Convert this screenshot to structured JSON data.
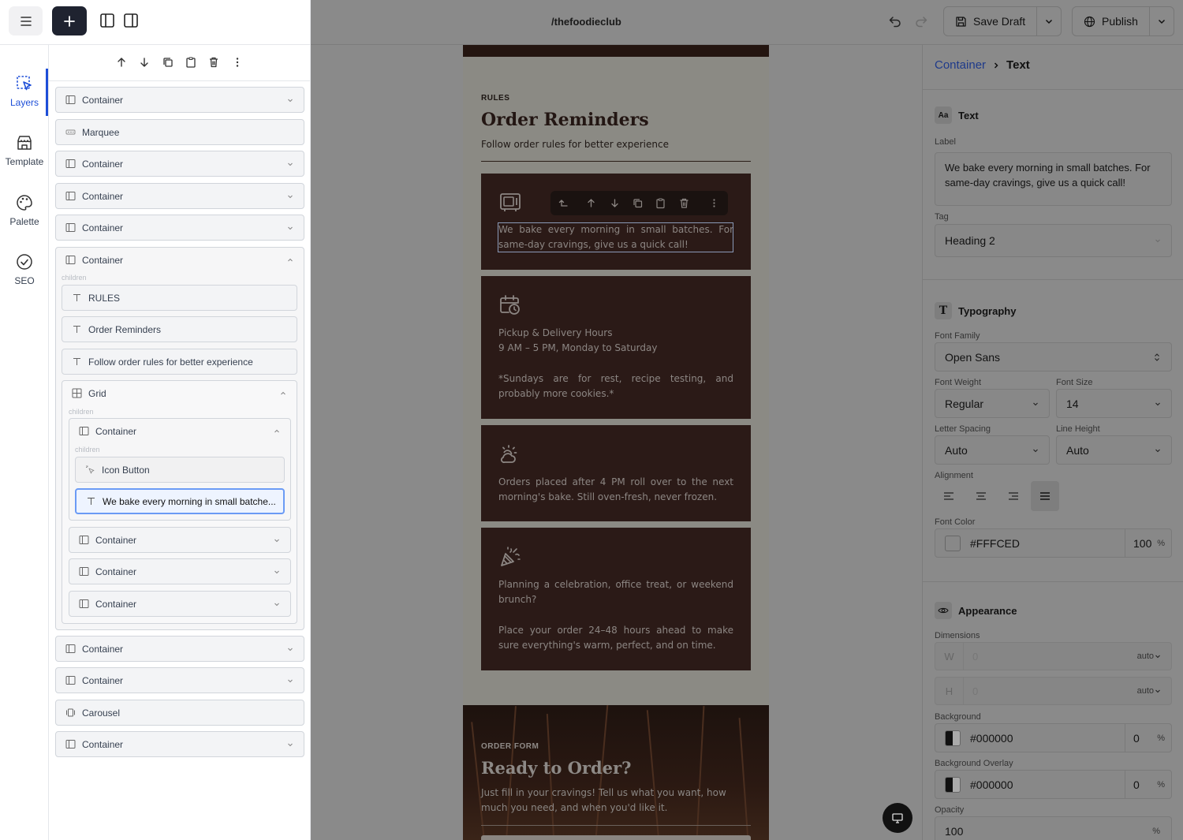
{
  "site": {
    "name": "/thefoodieclub"
  },
  "header": {
    "save_label": "Save Draft",
    "publish_label": "Publish"
  },
  "rail": {
    "items": [
      {
        "label": "Layers"
      },
      {
        "label": "Template"
      },
      {
        "label": "Palette"
      },
      {
        "label": "SEO"
      }
    ]
  },
  "layers": {
    "children_label": "children",
    "items": [
      {
        "label": "Container"
      },
      {
        "label": "Marquee"
      },
      {
        "label": "Container"
      },
      {
        "label": "Container"
      },
      {
        "label": "Container"
      },
      {
        "label": "Container"
      },
      {
        "label": "RULES"
      },
      {
        "label": "Order Reminders"
      },
      {
        "label": "Follow order rules for better experience"
      },
      {
        "label": "Grid"
      },
      {
        "label": "Container"
      },
      {
        "label": "Icon Button"
      },
      {
        "label": "We bake every morning in small batche..."
      },
      {
        "label": "Container"
      },
      {
        "label": "Container"
      },
      {
        "label": "Container"
      },
      {
        "label": "Container"
      },
      {
        "label": "Container"
      },
      {
        "label": "Carousel"
      },
      {
        "label": "Container"
      }
    ]
  },
  "canvas": {
    "rules_label": "RULES",
    "rules_title": "Order Reminders",
    "rules_subtitle": "Follow order rules for better experience",
    "cards": [
      {
        "icon": "oven-icon",
        "text": "We bake every morning in small batches. For same-day cravings, give us a quick call!"
      },
      {
        "icon": "calendar-clock-icon",
        "line1": "Pickup & Delivery Hours",
        "line2": "9 AM – 5 PM, Monday to Saturday",
        "line3": "*Sundays are for rest, recipe testing, and probably more cookies.*"
      },
      {
        "icon": "sun-cloud-icon",
        "text": "Orders placed after 4 PM roll over to the next morning's bake. Still oven-fresh, never frozen."
      },
      {
        "icon": "party-popper-icon",
        "text": "Planning a celebration, office treat, or weekend brunch?",
        "text2": "Place your order 24–48 hours ahead to make sure everything's warm, perfect, and on time."
      }
    ],
    "order_label": "ORDER FORM",
    "order_title": "Ready to Order?",
    "order_text": "Just fill in your cravings! Tell us what you want, how much you need, and when you'd like it."
  },
  "inspector": {
    "breadcrumb_parent": "Container",
    "breadcrumb_current": "Text",
    "text_section": {
      "icon_label": "Aa",
      "title": "Text",
      "label_label": "Label",
      "label_value": "We bake every morning in small batches. For same-day cravings, give us a quick call!",
      "tag_label": "Tag",
      "tag_value": "Heading 2"
    },
    "typography": {
      "icon_label": "T",
      "title": "Typography",
      "font_family_label": "Font Family",
      "font_family": "Open Sans",
      "font_weight_label": "Font Weight",
      "font_weight": "Regular",
      "font_size_label": "Font Size",
      "font_size": "14",
      "letter_spacing_label": "Letter Spacing",
      "letter_spacing": "Auto",
      "line_height_label": "Line Height",
      "line_height": "Auto",
      "alignment_label": "Alignment",
      "alignment_selected": "justify",
      "font_color_label": "Font Color",
      "font_color": "#FFFCED",
      "font_color_opacity": "100",
      "pct": "%"
    },
    "appearance": {
      "title": "Appearance",
      "dimensions_label": "Dimensions",
      "w_key": "W",
      "w_value": "0",
      "w_unit": "auto",
      "h_key": "H",
      "h_value": "0",
      "h_unit": "auto",
      "background_label": "Background",
      "background": "#000000",
      "background_opacity": "0",
      "overlay_label": "Background Overlay",
      "overlay": "#000000",
      "overlay_opacity": "0",
      "opacity_label": "Opacity",
      "opacity": "100"
    }
  },
  "colors": {
    "accent": "#1d4ed8",
    "card_bg": "#2b1a17"
  }
}
